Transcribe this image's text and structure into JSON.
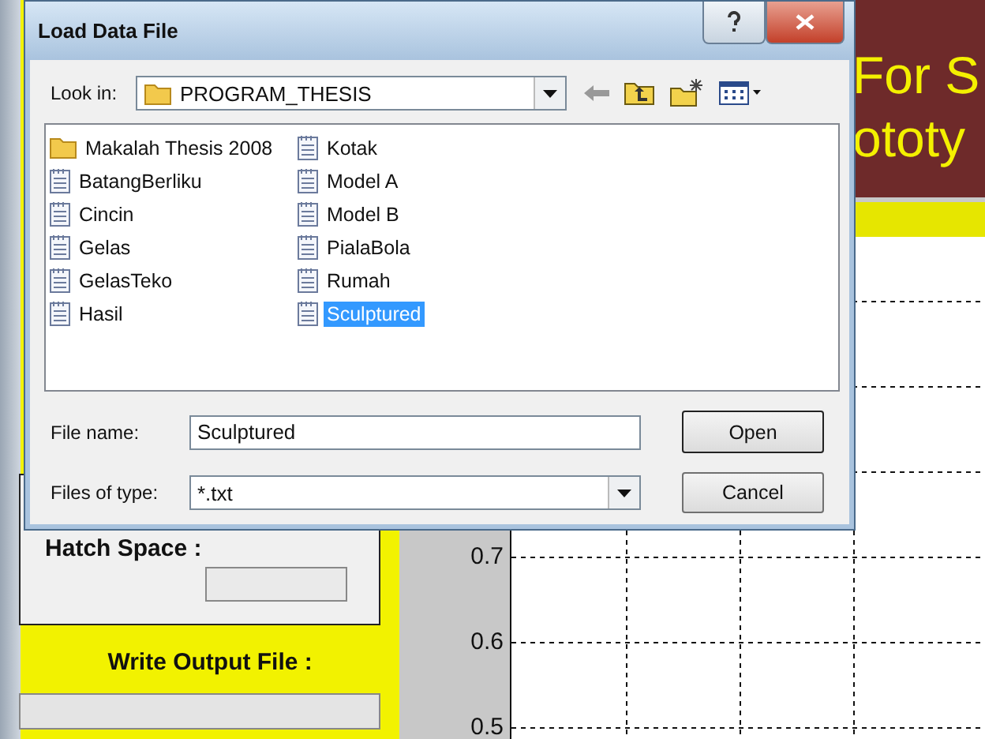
{
  "background_app": {
    "banner": [
      "For S",
      "ototy"
    ],
    "panel": {
      "hatch_label": "Hatch Space :",
      "output_label": "Write Output File :"
    },
    "plot": {
      "yticks": [
        "0.7",
        "0.6",
        "0.5"
      ]
    }
  },
  "dialog": {
    "title": "Load Data File",
    "look_in": {
      "label": "Look in:",
      "value": "PROGRAM_THESIS"
    },
    "files": [
      {
        "name": "Makalah Thesis 2008",
        "kind": "folder",
        "selected": false
      },
      {
        "name": "BatangBerliku",
        "kind": "file",
        "selected": false
      },
      {
        "name": "Cincin",
        "kind": "file",
        "selected": false
      },
      {
        "name": "Gelas",
        "kind": "file",
        "selected": false
      },
      {
        "name": "GelasTeko",
        "kind": "file",
        "selected": false
      },
      {
        "name": "Hasil",
        "kind": "file",
        "selected": false
      },
      {
        "name": "Kotak",
        "kind": "file",
        "selected": false
      },
      {
        "name": "Model A",
        "kind": "file",
        "selected": false
      },
      {
        "name": "Model B",
        "kind": "file",
        "selected": false
      },
      {
        "name": "PialaBola",
        "kind": "file",
        "selected": false
      },
      {
        "name": "Rumah",
        "kind": "file",
        "selected": false
      },
      {
        "name": "Sculptured",
        "kind": "file",
        "selected": true
      }
    ],
    "file_name": {
      "label": "File name:",
      "value": "Sculptured"
    },
    "file_type": {
      "label": "Files of type:",
      "value": "*.txt"
    },
    "buttons": [
      "Open",
      "Cancel"
    ]
  }
}
